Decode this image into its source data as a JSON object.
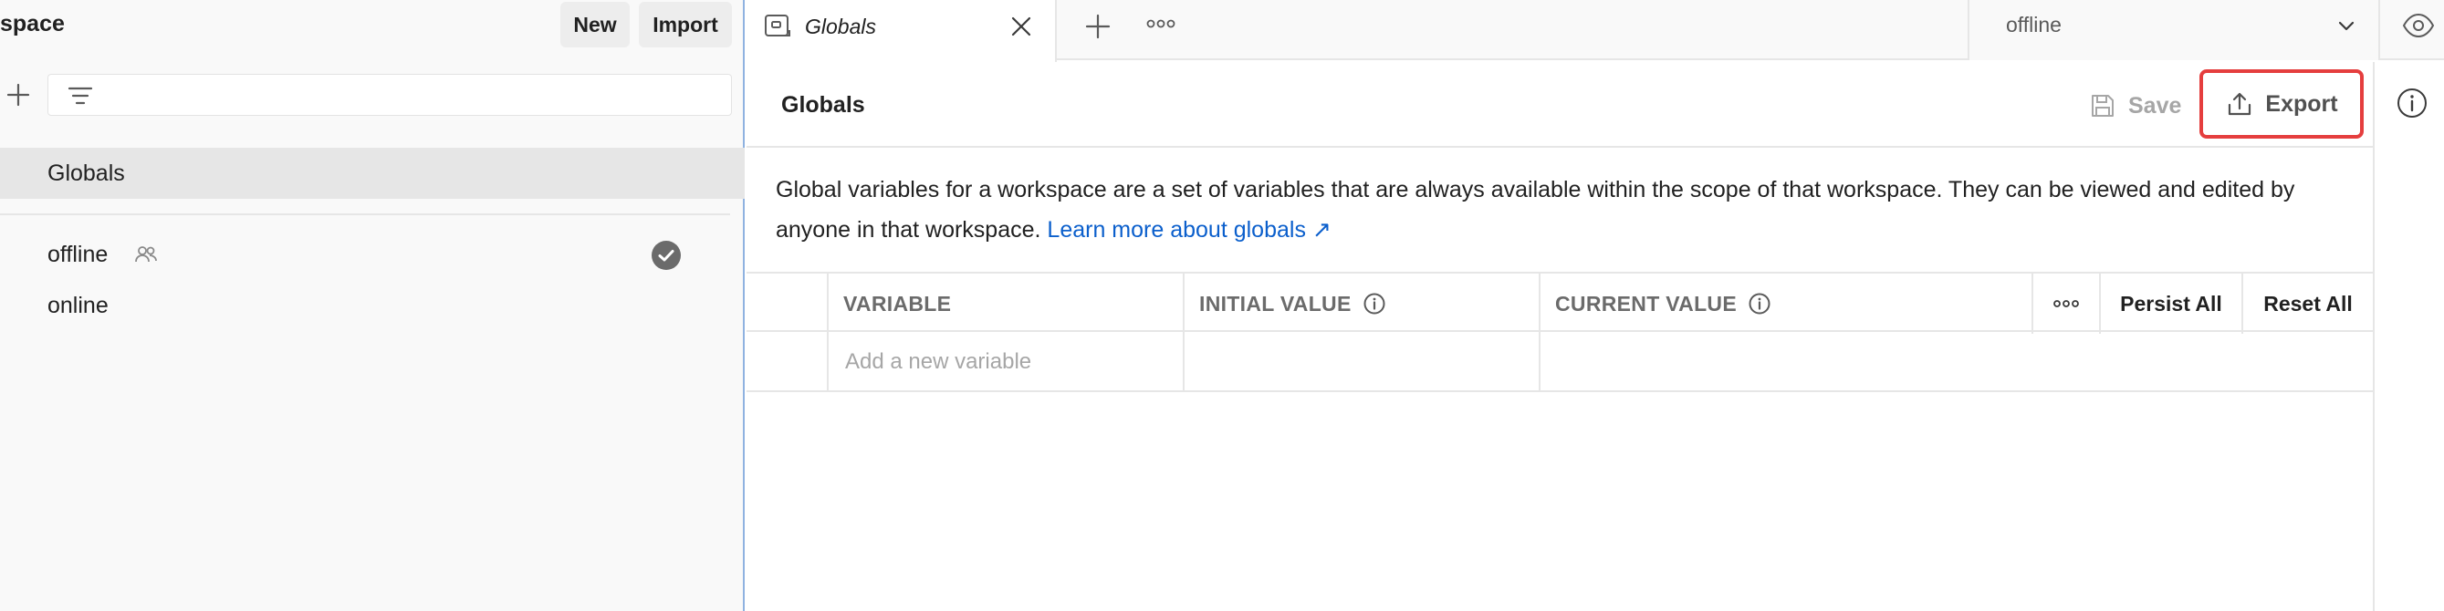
{
  "sidebar": {
    "title": "space",
    "new_label": "New",
    "import_label": "Import",
    "globals_label": "Globals",
    "environments": [
      {
        "name": "offline",
        "shared": true,
        "active": true
      },
      {
        "name": "online",
        "shared": false,
        "active": false
      }
    ]
  },
  "tabs": {
    "active_tab_label": "Globals"
  },
  "environment_selector": {
    "selected": "offline"
  },
  "main": {
    "title": "Globals",
    "save_label": "Save",
    "export_label": "Export",
    "description": "Global variables for a workspace are a set of variables that are always available within the scope of that workspace. They can be viewed and edited by anyone in that workspace.",
    "learn_more_label": "Learn more about globals ↗",
    "table": {
      "col_variable": "VARIABLE",
      "col_initial": "INITIAL VALUE",
      "col_current": "CURRENT VALUE",
      "persist_all": "Persist All",
      "reset_all": "Reset All",
      "new_variable_placeholder": "Add a new variable"
    }
  },
  "colors": {
    "highlight_border": "#e53e3e",
    "link": "#0b5fcc",
    "active_env_check": "#6b6b6b"
  }
}
